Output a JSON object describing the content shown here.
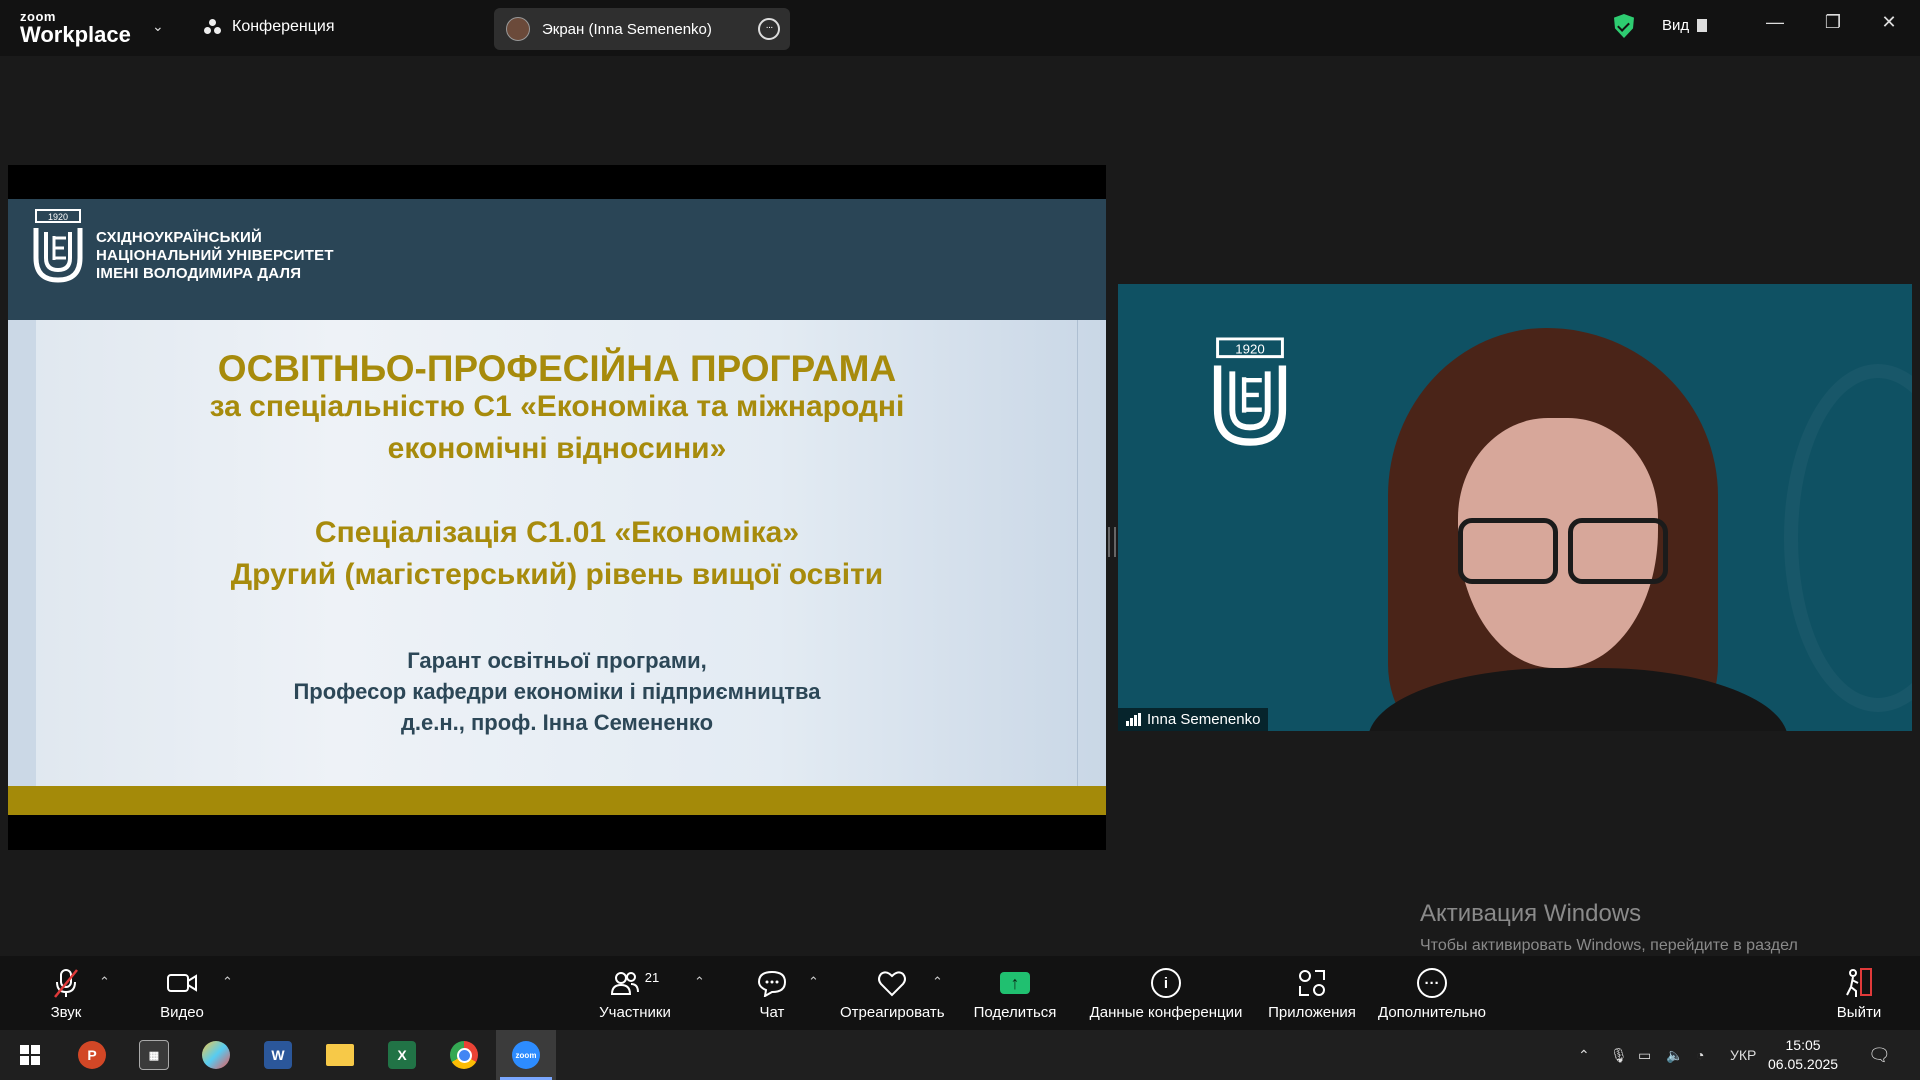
{
  "window": {
    "brand_top": "zoom",
    "brand_bottom": "Workplace",
    "meeting_menu": "Конференция",
    "screen_share_label": "Экран (Inna Semenenko)",
    "view_label": "Вид"
  },
  "slide": {
    "university_line1": "СХІДНОУКРАЇНСЬКИЙ",
    "university_line2": "НАЦІОНАЛЬНИЙ УНІВЕРСИТЕТ",
    "university_line3": "ІМЕНІ ВОЛОДИМИРА ДАЛЯ",
    "logo_year": "1920",
    "title": "ОСВІТНЬО-ПРОФЕСІЙНА ПРОГРАМА",
    "subtitle_line1": "за спеціальністю С1 «Економіка та міжнародні",
    "subtitle_line2": "економічні відносини»",
    "specialization": "Спеціалізація С1.01 «Економіка»",
    "level": "Другий (магістерський) рівень вищої освіти",
    "guarantor_line1": "Гарант освітньої програми,",
    "guarantor_line2": "Професор кафедри економіки і підприємництва",
    "guarantor_line3": "д.е.н., проф. Інна Семененко"
  },
  "video": {
    "participant_name": "Inna Semenenko",
    "logo_year": "1920"
  },
  "activation": {
    "title": "Активация Windows",
    "text": "Чтобы активировать Windows, перейдите в раздел \"Параметры\"."
  },
  "toolbar": {
    "audio": "Звук",
    "video": "Видео",
    "participants": "Участники",
    "participants_count": "21",
    "chat": "Чат",
    "react": "Отреагировать",
    "share": "Поделиться",
    "meeting_info": "Данные конференции",
    "apps": "Приложения",
    "more": "Дополнительно",
    "leave": "Выйти"
  },
  "taskbar": {
    "language": "УКР",
    "time": "15:05",
    "date": "06.05.2025"
  },
  "colors": {
    "slide_header": "#2a4556",
    "slide_title": "#a78b0c",
    "slide_footer": "#a48a09",
    "video_bg": "#0f5163",
    "share_green": "#20c070",
    "leave_red": "#e03a3a"
  }
}
